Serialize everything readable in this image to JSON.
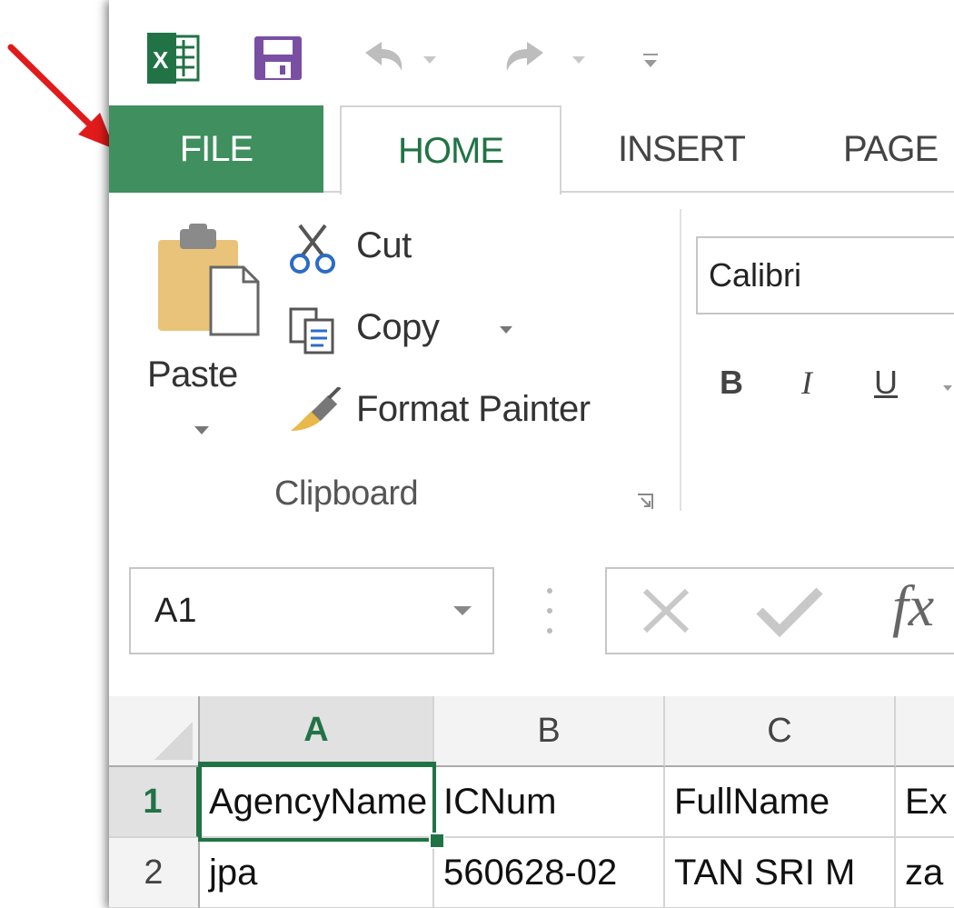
{
  "qat": {
    "app_icon": "excel-icon",
    "save_icon": "save-icon",
    "undo_icon": "undo-icon",
    "redo_icon": "redo-icon",
    "customize_icon": "customize-qat-icon"
  },
  "tabs": [
    {
      "label": "FILE"
    },
    {
      "label": "HOME"
    },
    {
      "label": "INSERT"
    },
    {
      "label": "PAGE"
    }
  ],
  "clipboard": {
    "paste_label": "Paste",
    "cut_label": "Cut",
    "copy_label": "Copy",
    "format_painter_label": "Format Painter",
    "group_label": "Clipboard"
  },
  "font": {
    "name": "Calibri",
    "bold": "B",
    "italic": "I",
    "underline": "U"
  },
  "formula_bar": {
    "name_box": "A1",
    "fx": "fx"
  },
  "grid": {
    "columns": [
      "A",
      "B",
      "C"
    ],
    "rows": [
      {
        "num": "1",
        "cells": [
          "AgencyName",
          "ICNum",
          "FullName",
          "Ex"
        ]
      },
      {
        "num": "2",
        "cells": [
          "jpa",
          "560628-02",
          "TAN SRI M",
          "za"
        ]
      }
    ]
  },
  "colors": {
    "file_tab": "#3f8f5f",
    "accent": "#217346",
    "arrow": "#e11b1b"
  },
  "annotation": {
    "arrow_icon": "red-arrow-icon"
  }
}
